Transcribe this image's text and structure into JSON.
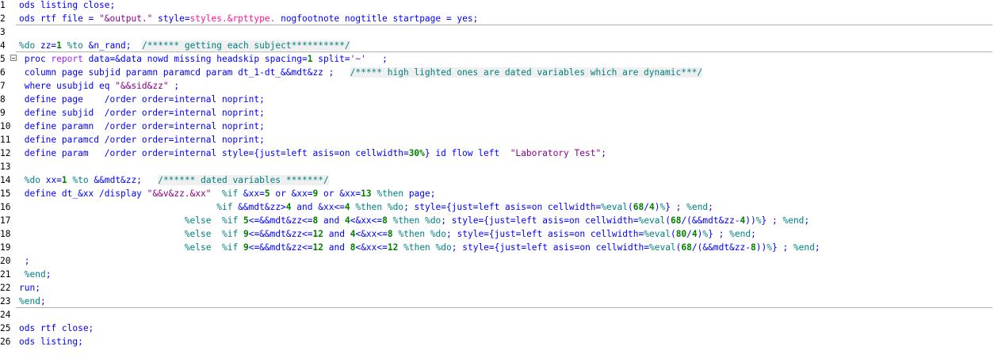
{
  "editor": {
    "lines": [
      {
        "num": "1",
        "parts": [
          [
            "k",
            "ods listing close;"
          ]
        ]
      },
      {
        "num": "2",
        "parts": [
          [
            "k",
            "ods rtf file = "
          ],
          [
            "s",
            "\"&output.\""
          ],
          [
            "k",
            " style="
          ],
          [
            "t",
            "styles.&rpttype."
          ],
          [
            "k",
            " nogfootnote nogtitle startpage = yes;"
          ]
        ]
      },
      {
        "num": "3",
        "parts": []
      },
      {
        "num": "4",
        "parts": [
          [
            "m",
            "%do"
          ],
          [
            "k",
            " zz="
          ],
          [
            "n",
            "1"
          ],
          [
            "k",
            " "
          ],
          [
            "m",
            "%to"
          ],
          [
            "k",
            " &n_rand;  "
          ],
          [
            "c",
            "/****** getting each subject**********/"
          ]
        ]
      },
      {
        "num": "5",
        "fold": "⊟",
        "parts": [
          [
            "k",
            " proc "
          ],
          [
            "r",
            "report"
          ],
          [
            "k",
            " data=&data nowd missing headskip spacing="
          ],
          [
            "n",
            "1"
          ],
          [
            "k",
            " split="
          ],
          [
            "s",
            "'~'"
          ],
          [
            "k",
            "   ;"
          ]
        ]
      },
      {
        "num": "6",
        "parts": [
          [
            "k",
            " column page subjid paramn paramcd param dt_1-dt_&&mdt&zz ;   "
          ],
          [
            "c",
            "/***** high lighted ones are dated variables which are dynamic***/"
          ]
        ]
      },
      {
        "num": "7",
        "parts": [
          [
            "k",
            " where usubjid eq "
          ],
          [
            "s",
            "\"&&sid&zz\""
          ],
          [
            "k",
            " ;"
          ]
        ]
      },
      {
        "num": "8",
        "parts": [
          [
            "k",
            " define page    /order order=internal noprint;"
          ]
        ]
      },
      {
        "num": "9",
        "parts": [
          [
            "k",
            " define subjid  /order order=internal noprint;"
          ]
        ]
      },
      {
        "num": "10",
        "parts": [
          [
            "k",
            " define paramn  /order order=internal noprint;"
          ]
        ]
      },
      {
        "num": "11",
        "parts": [
          [
            "k",
            " define paramcd /order order=internal noprint;"
          ]
        ]
      },
      {
        "num": "12",
        "parts": [
          [
            "k",
            " define param   /order order=internal style={just=left asis=on cellwidth="
          ],
          [
            "n",
            "30%"
          ],
          [
            "k",
            "} id flow left  "
          ],
          [
            "s",
            "\"Laboratory Test\""
          ],
          [
            "k",
            ";"
          ]
        ]
      },
      {
        "num": "13",
        "parts": []
      },
      {
        "num": "14",
        "parts": [
          [
            "k",
            " "
          ],
          [
            "m",
            "%do"
          ],
          [
            "k",
            " xx="
          ],
          [
            "n",
            "1"
          ],
          [
            "k",
            " "
          ],
          [
            "m",
            "%to"
          ],
          [
            "k",
            " &&mdt&zz;   "
          ],
          [
            "c",
            "/****** dated variables *******/"
          ]
        ]
      },
      {
        "num": "15",
        "parts": [
          [
            "k",
            " define dt_&xx /display "
          ],
          [
            "s",
            "\"&&v&zz.&xx\""
          ],
          [
            "k",
            "  "
          ],
          [
            "m",
            "%if"
          ],
          [
            "k",
            " &xx="
          ],
          [
            "n",
            "5"
          ],
          [
            "k",
            " or &xx="
          ],
          [
            "n",
            "9"
          ],
          [
            "k",
            " or &xx="
          ],
          [
            "n",
            "13"
          ],
          [
            "k",
            " "
          ],
          [
            "m",
            "%then"
          ],
          [
            "k",
            " page;"
          ]
        ]
      },
      {
        "num": "16",
        "parts": [
          [
            "k",
            "                                     "
          ],
          [
            "m",
            "%if"
          ],
          [
            "k",
            " &&mdt&zz>"
          ],
          [
            "n",
            "4"
          ],
          [
            "k",
            " and &xx<="
          ],
          [
            "n",
            "4"
          ],
          [
            "k",
            " "
          ],
          [
            "m",
            "%then"
          ],
          [
            "k",
            " "
          ],
          [
            "m",
            "%do"
          ],
          [
            "k",
            "; style={just=left asis=on cellwidth="
          ],
          [
            "m",
            "%eval"
          ],
          [
            "k",
            "("
          ],
          [
            "n",
            "68"
          ],
          [
            "k",
            "/"
          ],
          [
            "n",
            "4"
          ],
          [
            "k",
            ")"
          ],
          [
            "m",
            "%"
          ],
          [
            "k",
            "} ; "
          ],
          [
            "m",
            "%end"
          ],
          [
            "k",
            ";"
          ]
        ]
      },
      {
        "num": "17",
        "parts": [
          [
            "k",
            "                               "
          ],
          [
            "m",
            "%else"
          ],
          [
            "k",
            "  "
          ],
          [
            "m",
            "%if"
          ],
          [
            "k",
            " "
          ],
          [
            "n",
            "5"
          ],
          [
            "k",
            "<=&&mdt&zz<="
          ],
          [
            "n",
            "8"
          ],
          [
            "k",
            " and "
          ],
          [
            "n",
            "4"
          ],
          [
            "k",
            "<&xx<="
          ],
          [
            "n",
            "8"
          ],
          [
            "k",
            " "
          ],
          [
            "m",
            "%then"
          ],
          [
            "k",
            " "
          ],
          [
            "m",
            "%do"
          ],
          [
            "k",
            "; style={just=left asis=on cellwidth="
          ],
          [
            "m",
            "%eval"
          ],
          [
            "k",
            "("
          ],
          [
            "n",
            "68"
          ],
          [
            "k",
            "/(&&mdt&zz-"
          ],
          [
            "n",
            "4"
          ],
          [
            "k",
            "))"
          ],
          [
            "m",
            "%"
          ],
          [
            "k",
            "} ; "
          ],
          [
            "m",
            "%end"
          ],
          [
            "k",
            ";"
          ]
        ]
      },
      {
        "num": "18",
        "parts": [
          [
            "k",
            "                               "
          ],
          [
            "m",
            "%else"
          ],
          [
            "k",
            "  "
          ],
          [
            "m",
            "%if"
          ],
          [
            "k",
            " "
          ],
          [
            "n",
            "9"
          ],
          [
            "k",
            "<=&&mdt&zz<="
          ],
          [
            "n",
            "12"
          ],
          [
            "k",
            " and "
          ],
          [
            "n",
            "4"
          ],
          [
            "k",
            "<&xx<="
          ],
          [
            "n",
            "8"
          ],
          [
            "k",
            " "
          ],
          [
            "m",
            "%then"
          ],
          [
            "k",
            " "
          ],
          [
            "m",
            "%do"
          ],
          [
            "k",
            "; style={just=left asis=on cellwidth="
          ],
          [
            "m",
            "%eval"
          ],
          [
            "k",
            "("
          ],
          [
            "n",
            "80"
          ],
          [
            "k",
            "/"
          ],
          [
            "n",
            "4"
          ],
          [
            "k",
            ")"
          ],
          [
            "m",
            "%"
          ],
          [
            "k",
            "} ; "
          ],
          [
            "m",
            "%end"
          ],
          [
            "k",
            ";"
          ]
        ]
      },
      {
        "num": "19",
        "parts": [
          [
            "k",
            "                               "
          ],
          [
            "m",
            "%else"
          ],
          [
            "k",
            "  "
          ],
          [
            "m",
            "%if"
          ],
          [
            "k",
            " "
          ],
          [
            "n",
            "9"
          ],
          [
            "k",
            "<=&&mdt&zz<="
          ],
          [
            "n",
            "12"
          ],
          [
            "k",
            " and "
          ],
          [
            "n",
            "8"
          ],
          [
            "k",
            "<&xx<="
          ],
          [
            "n",
            "12"
          ],
          [
            "k",
            " "
          ],
          [
            "m",
            "%then"
          ],
          [
            "k",
            " "
          ],
          [
            "m",
            "%do"
          ],
          [
            "k",
            "; style={just=left asis=on cellwidth="
          ],
          [
            "m",
            "%eval"
          ],
          [
            "k",
            "("
          ],
          [
            "n",
            "68"
          ],
          [
            "k",
            "/(&&mdt&zz-"
          ],
          [
            "n",
            "8"
          ],
          [
            "k",
            "))"
          ],
          [
            "m",
            "%"
          ],
          [
            "k",
            "} ; "
          ],
          [
            "m",
            "%end"
          ],
          [
            "k",
            ";"
          ]
        ]
      },
      {
        "num": "20",
        "parts": [
          [
            "k",
            " ;"
          ]
        ]
      },
      {
        "num": "21",
        "parts": [
          [
            "k",
            " "
          ],
          [
            "m",
            "%end"
          ],
          [
            "k",
            ";"
          ]
        ]
      },
      {
        "num": "22",
        "parts": [
          [
            "k",
            "run;"
          ]
        ]
      },
      {
        "num": "23",
        "parts": [
          [
            "m",
            "%end"
          ],
          [
            "k",
            ";"
          ]
        ]
      },
      {
        "num": "24",
        "parts": []
      },
      {
        "num": "25",
        "parts": [
          [
            "k",
            "ods rtf close;"
          ]
        ]
      },
      {
        "num": "26",
        "parts": [
          [
            "k",
            "ods listing;"
          ]
        ]
      }
    ],
    "separators_after": [
      "2",
      "4",
      "23"
    ]
  }
}
